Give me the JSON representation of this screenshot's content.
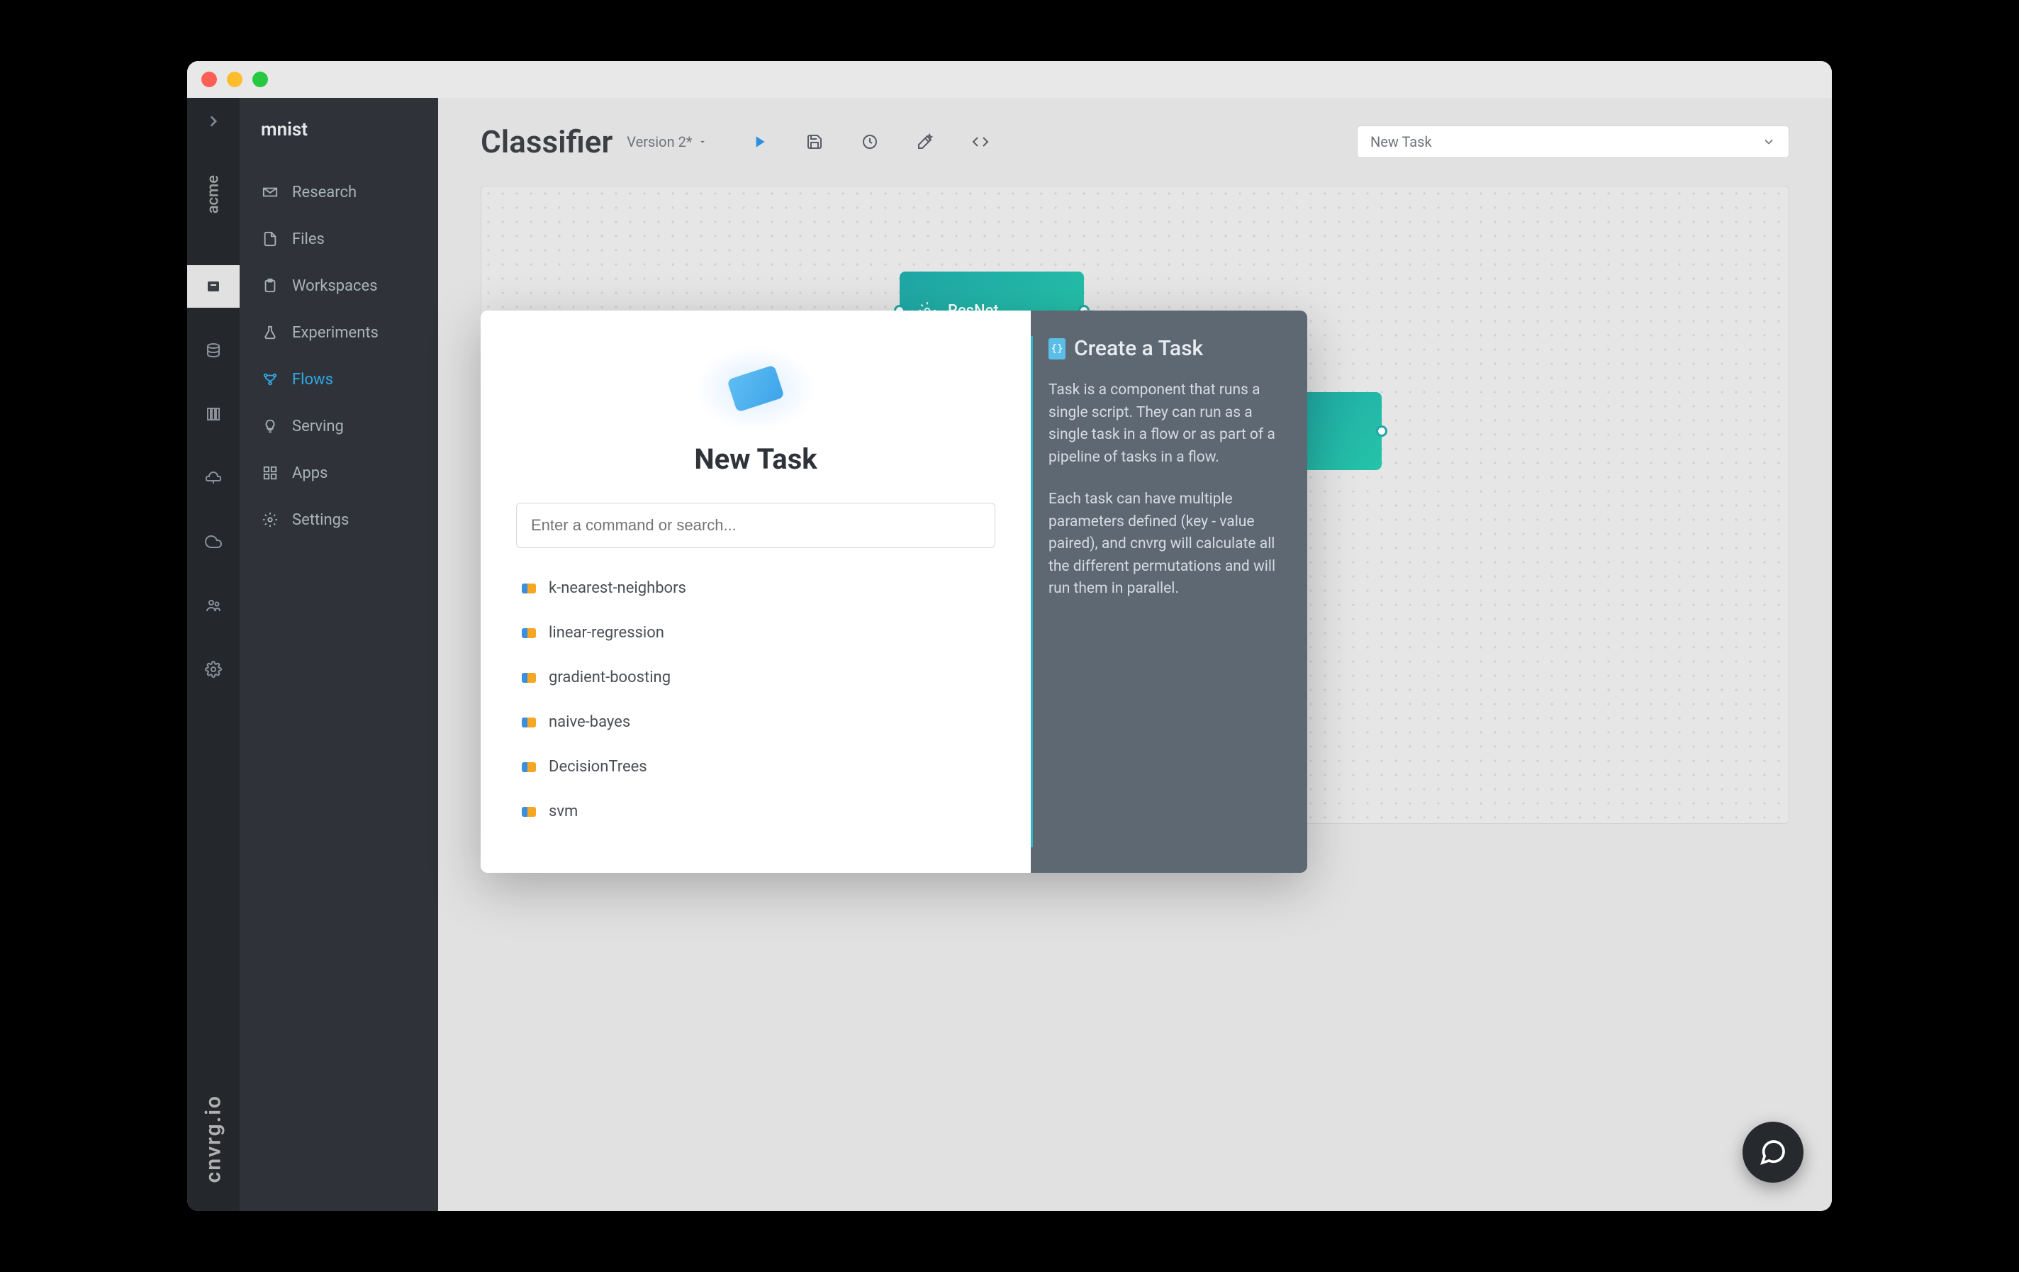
{
  "rail": {
    "org_label": "acme",
    "brand": "cnvrg.io"
  },
  "sidebar": {
    "title": "mnist",
    "items": [
      {
        "label": "Research"
      },
      {
        "label": "Files"
      },
      {
        "label": "Workspaces"
      },
      {
        "label": "Experiments"
      },
      {
        "label": "Flows"
      },
      {
        "label": "Serving"
      },
      {
        "label": "Apps"
      },
      {
        "label": "Settings"
      }
    ]
  },
  "header": {
    "title": "Classifier",
    "version": "Version 2*",
    "dropdown": "New Task"
  },
  "canvas": {
    "node_resnet": "ResNet"
  },
  "modal": {
    "title": "New Task",
    "search_placeholder": "Enter a command or search...",
    "tasks": [
      {
        "label": "k-nearest-neighbors"
      },
      {
        "label": "linear-regression"
      },
      {
        "label": "gradient-boosting"
      },
      {
        "label": "naive-bayes"
      },
      {
        "label": "DecisionTrees"
      },
      {
        "label": "svm"
      }
    ],
    "info_title": "Create a Task",
    "info_p1": "Task is a component that runs a single script. They can run as a single task in a flow or as part of a pipeline of tasks in a flow.",
    "info_p2": "Each task can have multiple parameters defined (key - value paired), and cnvrg will calculate all the different permutations and will run them in parallel."
  }
}
